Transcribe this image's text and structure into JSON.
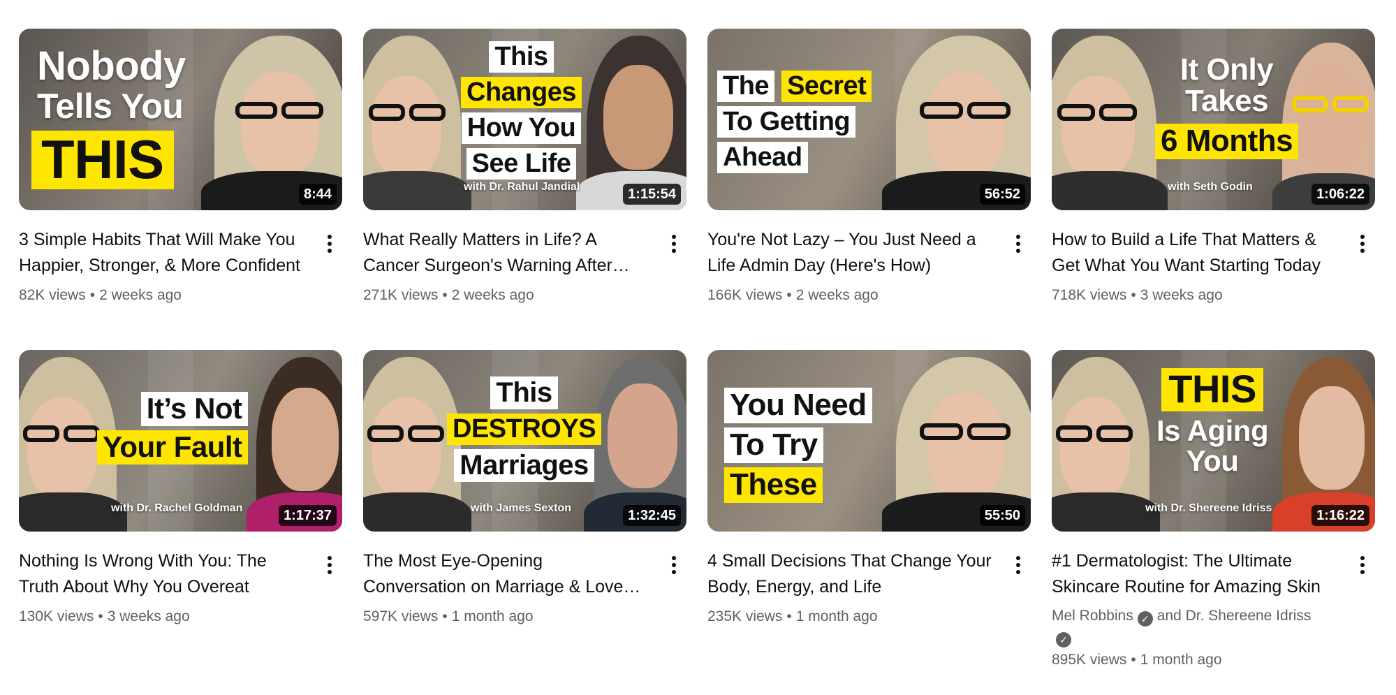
{
  "videos": [
    {
      "thumb_lines": [
        {
          "text": "Nobody",
          "style": "plain"
        },
        {
          "text": "Tells You",
          "style": "plain"
        },
        {
          "text": "THIS",
          "style": "yellow"
        }
      ],
      "guest_label": "",
      "duration": "8:44",
      "title": "3 Simple Habits That Will Make You Happier, Stronger, & More Confident",
      "views": "82K views",
      "age": "2 weeks ago"
    },
    {
      "thumb_lines": [
        {
          "text": "This",
          "style": "white"
        },
        {
          "text": "Changes",
          "style": "yellow"
        },
        {
          "text": "How You",
          "style": "white"
        },
        {
          "text": "See Life",
          "style": "white"
        }
      ],
      "guest_label": "with Dr. Rahul Jandial",
      "duration": "1:15:54",
      "title": "What Really Matters in Life? A Cancer Surgeon's Warning After…",
      "views": "271K views",
      "age": "2 weeks ago"
    },
    {
      "thumb_lines": [
        {
          "text": "The",
          "style": "white",
          "inline_next": "Secret"
        },
        {
          "text": "To Getting",
          "style": "white"
        },
        {
          "text": "Ahead",
          "style": "white"
        }
      ],
      "guest_label": "",
      "duration": "56:52",
      "title": "You're Not Lazy – You Just Need a Life Admin Day (Here's How)",
      "views": "166K views",
      "age": "2 weeks ago"
    },
    {
      "thumb_lines": [
        {
          "text": "It Only",
          "style": "plain"
        },
        {
          "text": "Takes",
          "style": "plain"
        },
        {
          "text": "6 Months",
          "style": "yellow"
        }
      ],
      "guest_label": "with Seth Godin",
      "duration": "1:06:22",
      "title": "How to Build a Life That Matters & Get What You Want Starting Today",
      "views": "718K views",
      "age": "3 weeks ago"
    },
    {
      "thumb_lines": [
        {
          "text": "It’s Not",
          "style": "white"
        },
        {
          "text": "Your Fault",
          "style": "yellow"
        }
      ],
      "guest_label": "with Dr. Rachel Goldman",
      "duration": "1:17:37",
      "title": "Nothing Is Wrong With You: The Truth About Why You Overeat",
      "views": "130K views",
      "age": "3 weeks ago"
    },
    {
      "thumb_lines": [
        {
          "text": "This",
          "style": "white"
        },
        {
          "text": "DESTROYS",
          "style": "yellow"
        },
        {
          "text": "Marriages",
          "style": "white"
        }
      ],
      "guest_label": "with James Sexton",
      "duration": "1:32:45",
      "title": "The Most Eye-Opening Conversation on Marriage & Love…",
      "views": "597K views",
      "age": "1 month ago"
    },
    {
      "thumb_lines": [
        {
          "text": "You Need",
          "style": "white"
        },
        {
          "text": "To Try",
          "style": "white"
        },
        {
          "text": "These",
          "style": "yellow"
        }
      ],
      "guest_label": "",
      "duration": "55:50",
      "title": "4 Small Decisions That Change Your Body, Energy, and Life",
      "views": "235K views",
      "age": "1 month ago"
    },
    {
      "thumb_lines": [
        {
          "text": "THIS",
          "style": "yellow"
        },
        {
          "text": "Is Aging",
          "style": "plain"
        },
        {
          "text": "You",
          "style": "plain"
        }
      ],
      "guest_label": "with Dr. Shereene Idriss",
      "duration": "1:16:22",
      "title": "#1 Dermatologist: The Ultimate Skincare Routine for Amazing Skin",
      "channel": "Mel Robbins",
      "collab": "and Dr. Shereene Idriss",
      "views": "895K views",
      "age": "1 month ago"
    }
  ],
  "separator": "•",
  "colors": {
    "caption_yellow": "#ffe600",
    "meta_gray": "#606060",
    "title_text": "#0f0f0f"
  }
}
